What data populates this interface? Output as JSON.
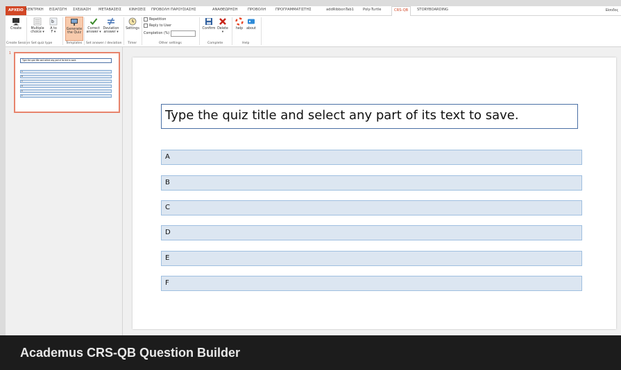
{
  "tabs": [
    "ΑΡΧΕΙΟ",
    "ΚΕΝΤΡΙΚΗ",
    "ΕΙΣΑΓΩΓΗ",
    "ΣΧΕΔΙΑΣΗ",
    "ΜΕΤΑΒΑΣΕΙΣ",
    "ΚΙΝΗΣΕΙΣ",
    "ΠΡΟΒΟΛΗ ΠΑΡΟΥΣΙΑΣΗΣ",
    "ΑΝΑΘΕΩΡΗΣΗ",
    "ΠΡΟΒΟΛΗ",
    "ΠΡΟΓΡΑΜΜΑΤΙΣΤΗΣ",
    "addRibbonTab1",
    "Poly-Turtle",
    "CRS-QB",
    "STORYBOARDING"
  ],
  "signin": "Είσοδος",
  "ribbon": {
    "create": "Create",
    "multiple_choice": [
      "Multiple",
      "choice ▾"
    ],
    "a_to_f": [
      "A to",
      "F ▾"
    ],
    "generate": [
      "Generate",
      "the Quiz"
    ],
    "correct": [
      "Correct",
      "answer ▾"
    ],
    "deviation": [
      "Deviation",
      "answer ▾"
    ],
    "settings": "Settings",
    "repetition": "Repetition",
    "reply_to_user": "Reply to User",
    "completion": "Completion (%)",
    "confirm": "Confirm",
    "delete": "Delete",
    "delete_arrow": "▾",
    "help": "help",
    "about": "about",
    "groups": {
      "create_session": "Create Session",
      "set_quiz_type": "Set quiz type",
      "templates": "Templates",
      "set_answer": "Set answer / deviation",
      "timer": "Timer",
      "other_settings": "Other settings",
      "complete": "Complete",
      "help": "Help"
    }
  },
  "thumbnail": {
    "slide_number": "1",
    "title": "Type the quiz title and select any part of its text to save.",
    "options": [
      "A",
      "B",
      "C",
      "D",
      "E",
      "F"
    ]
  },
  "slide": {
    "title": "Type the quiz title and select any part of its text to save.",
    "options": [
      "A",
      "B",
      "C",
      "D",
      "E",
      "F"
    ]
  },
  "footer": "Academus CRS-QB Question Builder",
  "colors": {
    "accent": "#d24726",
    "option_fill": "#dce6f1",
    "footer_bg": "#1c1c1c"
  }
}
